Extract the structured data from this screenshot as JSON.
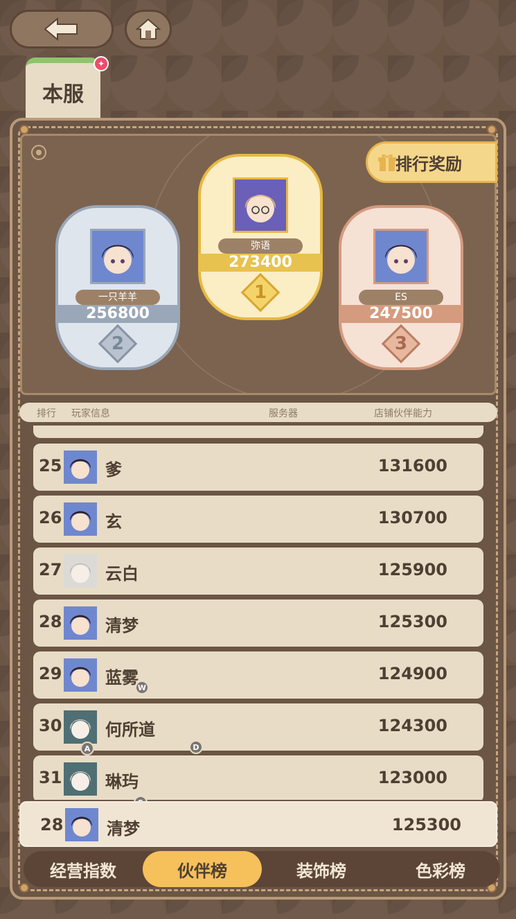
{
  "topbar": {
    "back_icon": "back-arrow-icon",
    "home_icon": "home-icon"
  },
  "server_tab": {
    "label": "本服",
    "badge": "✦"
  },
  "reward_button": {
    "label": "排行奖励",
    "icon": "gift-icon"
  },
  "podium": [
    {
      "rank": "2",
      "name": "一只羊羊",
      "score": "256800",
      "color": "#9aa7b8"
    },
    {
      "rank": "1",
      "name": "弥语",
      "score": "273400",
      "color": "#e8b840"
    },
    {
      "rank": "3",
      "name": "ES",
      "score": "247500",
      "color": "#d49b7f"
    }
  ],
  "list_header": {
    "rank": "排行",
    "player": "玩家信息",
    "server": "服务器",
    "power": "店铺伙伴能力"
  },
  "rows": [
    {
      "rank": "25",
      "name": "爹",
      "score": "131600",
      "avatar": "dark-haired-avatar"
    },
    {
      "rank": "26",
      "name": "玄",
      "score": "130700",
      "avatar": "dark-haired-avatar"
    },
    {
      "rank": "27",
      "name": "云白",
      "score": "125900",
      "avatar": "white-haired-avatar"
    },
    {
      "rank": "28",
      "name": "清梦",
      "score": "125300",
      "avatar": "dark-haired-avatar"
    },
    {
      "rank": "29",
      "name": "蓝雾",
      "score": "124900",
      "avatar": "dark-haired-avatar"
    },
    {
      "rank": "30",
      "name": "何所道",
      "score": "124300",
      "avatar": "white-haired-avatar"
    },
    {
      "rank": "31",
      "name": "琳玙",
      "score": "123000",
      "avatar": "white-haired-avatar"
    }
  ],
  "self_row": {
    "rank": "28",
    "name": "清梦",
    "score": "125300"
  },
  "key_hints": {
    "w": "W",
    "a": "A",
    "d": "D",
    "s": "S"
  },
  "bottom_tabs": [
    {
      "label": "经营指数",
      "active": false
    },
    {
      "label": "伙伴榜",
      "active": true
    },
    {
      "label": "装饰榜",
      "active": false
    },
    {
      "label": "色彩榜",
      "active": false
    }
  ]
}
